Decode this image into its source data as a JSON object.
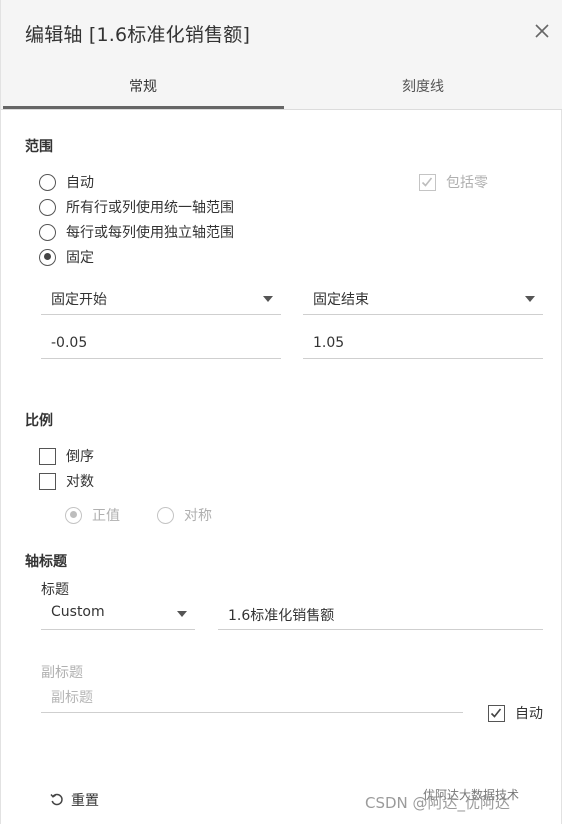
{
  "dialog": {
    "title": "编辑轴 [1.6标准化销售额]",
    "close_icon": "close-icon"
  },
  "tabs": [
    {
      "label": "常规",
      "active": true
    },
    {
      "label": "刻度线",
      "active": false
    }
  ],
  "range": {
    "heading": "范围",
    "options": [
      {
        "label": "自动",
        "selected": false
      },
      {
        "label": "所有行或列使用统一轴范围",
        "selected": false
      },
      {
        "label": "每行或每列使用独立轴范围",
        "selected": false
      },
      {
        "label": "固定",
        "selected": true
      }
    ],
    "include_zero": {
      "label": "包括零",
      "checked": true,
      "disabled": true
    },
    "fixed_start": {
      "mode": "固定开始",
      "value": "-0.05"
    },
    "fixed_end": {
      "mode": "固定结束",
      "value": "1.05"
    }
  },
  "scale": {
    "heading": "比例",
    "reversed": {
      "label": "倒序",
      "checked": false
    },
    "logarithmic": {
      "label": "对数",
      "checked": false
    },
    "log_positive": {
      "label": "正值",
      "selected": true,
      "disabled": true
    },
    "log_symmetric": {
      "label": "对称",
      "selected": false,
      "disabled": true
    }
  },
  "axis_titles": {
    "heading": "轴标题",
    "title_label": "标题",
    "title_mode": "Custom",
    "title_value": "1.6标准化销售额",
    "subtitle_label": "副标题",
    "subtitle_placeholder": "副标题",
    "subtitle_auto": {
      "label": "自动",
      "checked": true
    }
  },
  "footer": {
    "reset_label": "重置",
    "watermark": "CSDN @阿达_优阿达",
    "watermark_top": "优阿达大数据技术"
  },
  "colors": {
    "header_bg": "#f5f5f5",
    "tab_indicator": "#666666",
    "text": "#333333",
    "disabled": "#b0b0b0"
  }
}
